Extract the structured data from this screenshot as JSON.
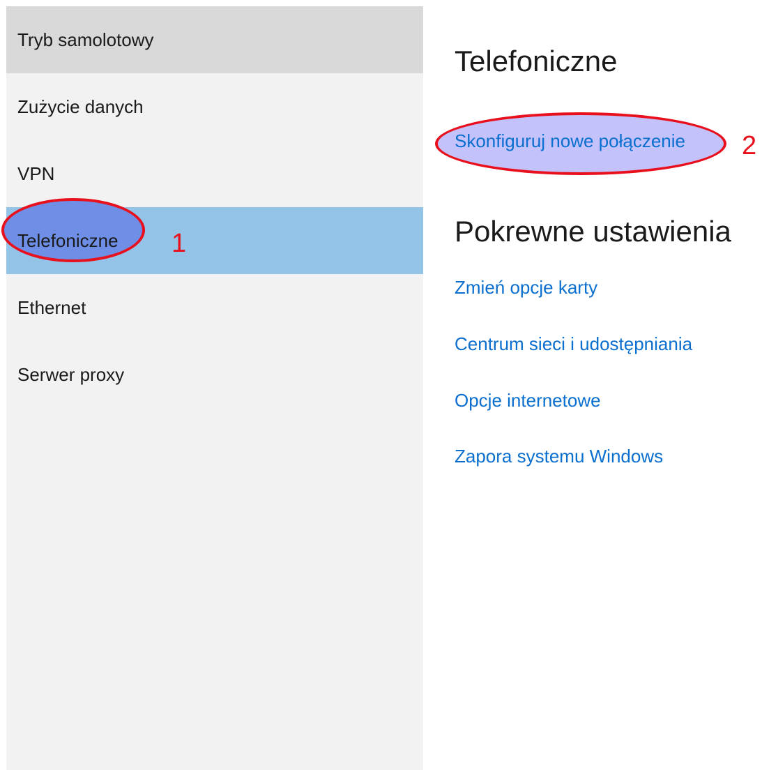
{
  "sidebar": {
    "items": [
      {
        "label": "Tryb samolotowy",
        "state": "hover"
      },
      {
        "label": "Zużycie danych",
        "state": "normal"
      },
      {
        "label": "VPN",
        "state": "normal"
      },
      {
        "label": "Telefoniczne",
        "state": "selected"
      },
      {
        "label": "Ethernet",
        "state": "normal"
      },
      {
        "label": "Serwer proxy",
        "state": "normal"
      }
    ]
  },
  "main": {
    "title": "Telefoniczne",
    "setup_link": "Skonfiguruj nowe połączenie",
    "related_title": "Pokrewne ustawienia",
    "related_links": [
      "Zmień opcje karty",
      "Centrum sieci i udostępniania",
      "Opcje internetowe",
      "Zapora systemu Windows"
    ]
  },
  "annotations": {
    "marker_1": "1",
    "marker_2": "2",
    "color": "#e8101c"
  },
  "colors": {
    "sidebar_bg": "#f2f2f2",
    "hover_bg": "#d9d9d9",
    "selected_bg": "#94c3e8",
    "link": "#0a6fce"
  }
}
